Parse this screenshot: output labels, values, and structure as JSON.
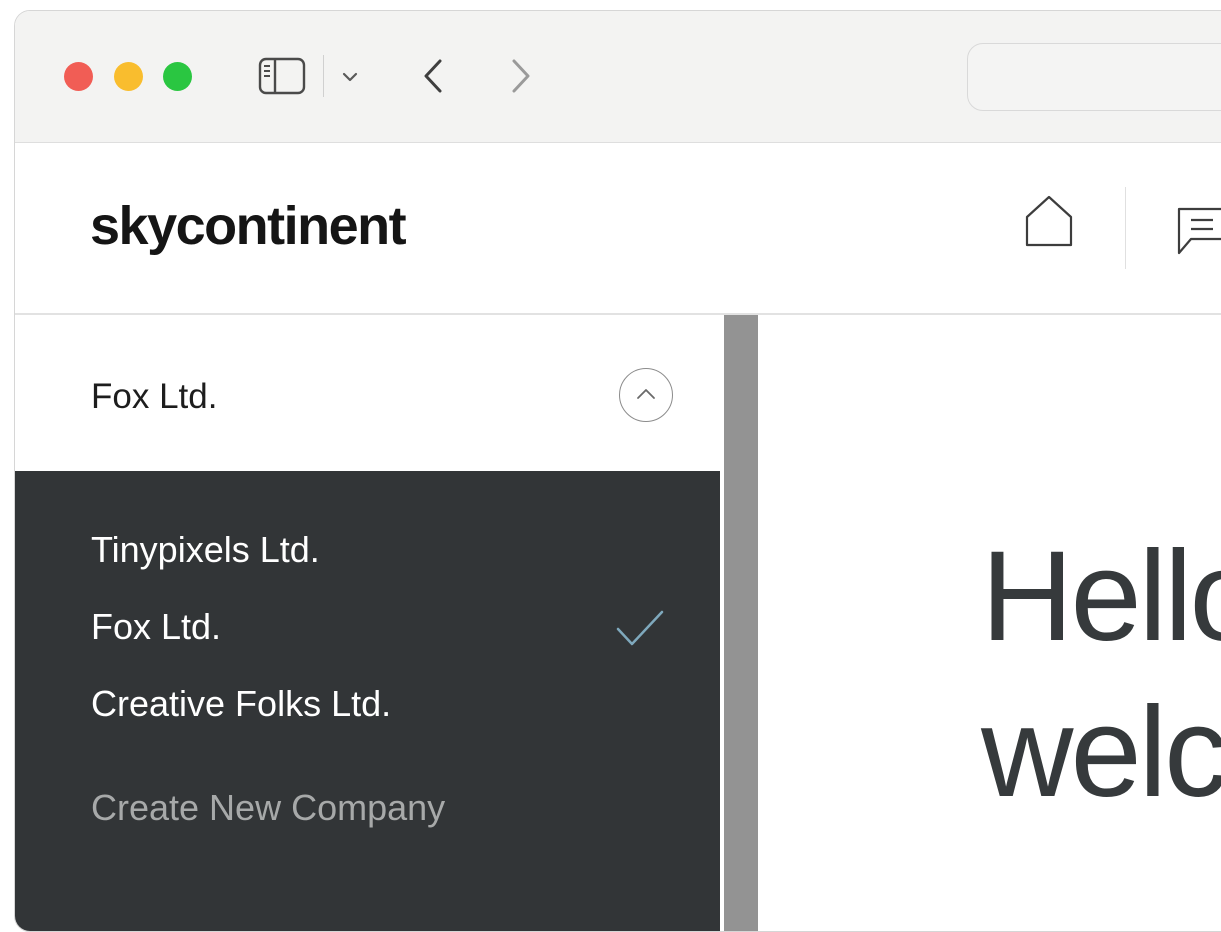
{
  "browser": {
    "icons": [
      "sidebar-toggle-icon",
      "chevron-down-icon",
      "back-arrow-icon",
      "forward-arrow-icon"
    ],
    "traffic_light_colors": {
      "close": "#f15d55",
      "minimize": "#f9bd2e",
      "zoom": "#2ac641"
    }
  },
  "header": {
    "logo": "skycontinent",
    "icons": [
      "home-icon",
      "chat-icon"
    ]
  },
  "company_switcher": {
    "current": "Fox Ltd.",
    "toggle_icon": "chevron-up-icon",
    "items": [
      {
        "label": "Tinypixels Ltd.",
        "selected": false
      },
      {
        "label": "Fox Ltd.",
        "selected": true
      },
      {
        "label": "Creative Folks Ltd.",
        "selected": false
      }
    ],
    "create_label": "Create New Company",
    "check_color": "#7fa9bd",
    "menu_bg": "#323537"
  },
  "main": {
    "greeting_line1": "Hello",
    "greeting_line2": "welcome"
  }
}
